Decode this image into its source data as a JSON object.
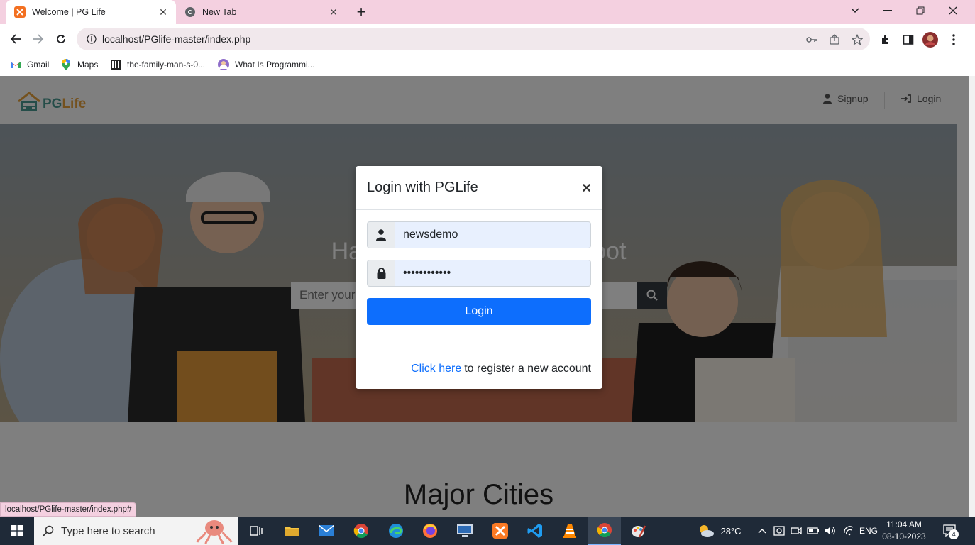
{
  "browser": {
    "tabs": [
      {
        "title": "Welcome | PG Life",
        "active": true,
        "favicon": "xampp-icon"
      },
      {
        "title": "New Tab",
        "active": false,
        "favicon": "chrome-icon"
      }
    ],
    "url": "localhost/PGlife-master/index.php",
    "bookmarks": [
      {
        "label": "Gmail",
        "icon": "gmail-icon"
      },
      {
        "label": "Maps",
        "icon": "maps-icon"
      },
      {
        "label": "the-family-man-s-0...",
        "icon": "bookmark-site-icon"
      },
      {
        "label": "What Is Programmi...",
        "icon": "bookmark-avatar-icon"
      }
    ],
    "status_url": "localhost/PGlife-master/index.php#"
  },
  "site": {
    "logo": {
      "part1": "PG",
      "part2": "Life"
    },
    "nav": {
      "signup": "Signup",
      "login": "Login"
    },
    "hero": {
      "title": "Happiness per Square Foot",
      "search_placeholder": "Enter your city to search for PGs"
    },
    "section_title": "Major Cities"
  },
  "modal": {
    "title": "Login with PGLife",
    "close": "×",
    "email_value": "newsdemo",
    "password_value": "••••••••••••",
    "login_button": "Login",
    "footer_link": "Click here",
    "footer_text": "to register a new account"
  },
  "taskbar": {
    "search_placeholder": "Type here to search",
    "weather": "28°C",
    "language": "ENG",
    "time": "11:04 AM",
    "date": "08-10-2023",
    "notifications": "4"
  },
  "colors": {
    "primary": "#0d6efd",
    "logo_teal": "#4a9b92",
    "logo_orange": "#e8a33d",
    "tabstrip": "#f4d0e0",
    "taskbar": "#1f2a38"
  }
}
